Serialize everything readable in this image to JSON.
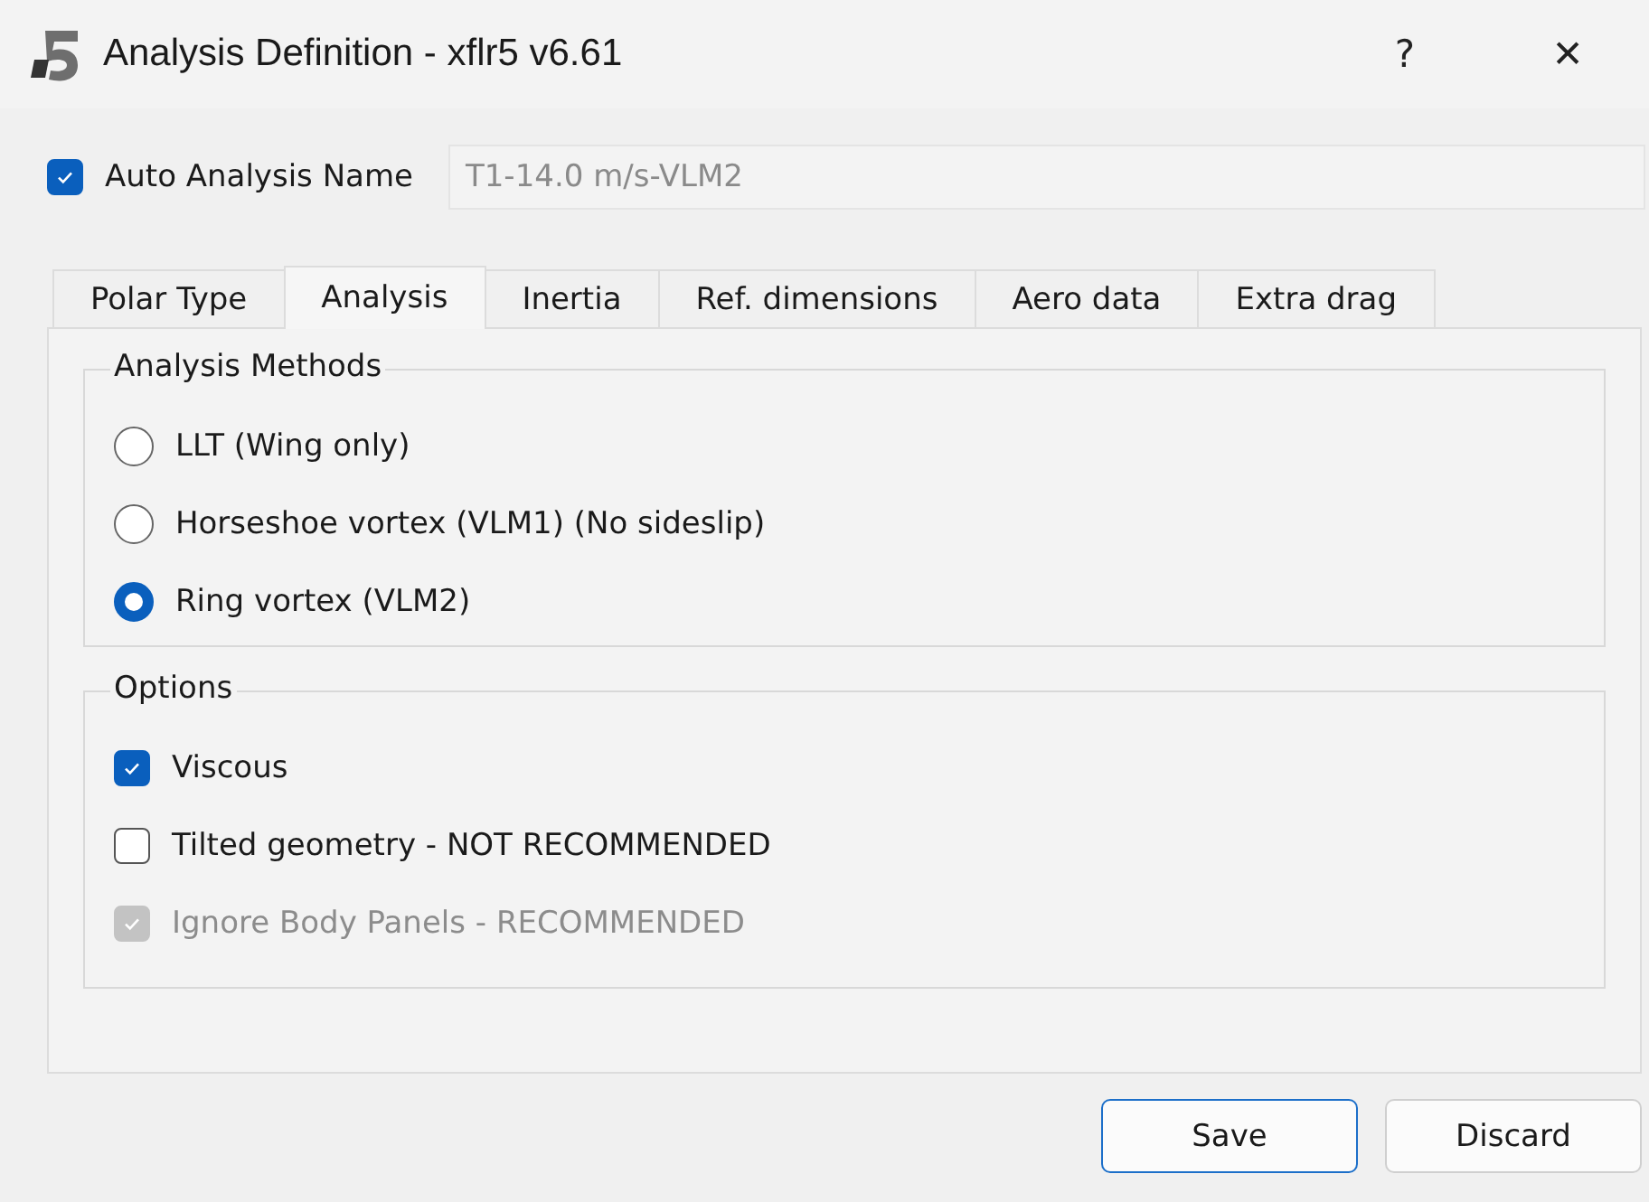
{
  "window": {
    "title": "Analysis Definition - xflr5 v6.61",
    "controls": [
      "?",
      "✕"
    ]
  },
  "auto_name": {
    "label": "Auto Analysis Name",
    "checked": true,
    "value": "T1-14.0 m/s-VLM2",
    "disabled": true
  },
  "tabs": [
    {
      "label": "Polar Type",
      "selected": false
    },
    {
      "label": "Analysis",
      "selected": true
    },
    {
      "label": "Inertia",
      "selected": false
    },
    {
      "label": "Ref. dimensions",
      "selected": false
    },
    {
      "label": "Aero data",
      "selected": false
    },
    {
      "label": "Extra drag",
      "selected": false
    }
  ],
  "analysis_methods": {
    "title": "Analysis Methods",
    "options": [
      {
        "label": "LLT (Wing only)",
        "selected": false
      },
      {
        "label": "Horseshoe vortex (VLM1) (No sideslip)",
        "selected": false
      },
      {
        "label": "Ring vortex (VLM2)",
        "selected": true
      }
    ]
  },
  "options": {
    "title": "Options",
    "items": [
      {
        "label": "Viscous",
        "checked": true,
        "disabled": false
      },
      {
        "label": "Tilted geometry - NOT RECOMMENDED",
        "checked": false,
        "disabled": false
      },
      {
        "label": "Ignore Body Panels - RECOMMENDED",
        "checked": true,
        "disabled": true
      }
    ]
  },
  "buttons": [
    {
      "label": "Save",
      "default": true
    },
    {
      "label": "Discard",
      "default": false
    }
  ]
}
